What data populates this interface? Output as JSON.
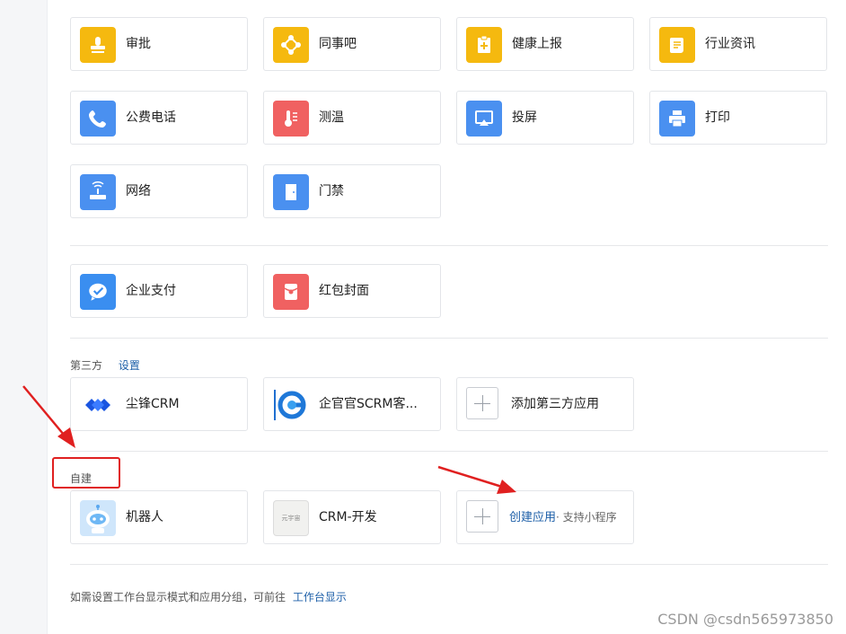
{
  "apps_basic": [
    {
      "label": "审批",
      "icon": "stamp-icon",
      "color": "#f5b90f"
    },
    {
      "label": "同事吧",
      "icon": "network-icon",
      "color": "#f5b90f"
    },
    {
      "label": "健康上报",
      "icon": "health-report-icon",
      "color": "#f5b90f"
    },
    {
      "label": "行业资讯",
      "icon": "news-scroll-icon",
      "color": "#f5b90f"
    },
    {
      "label": "公费电话",
      "icon": "phone-icon",
      "color": "#4a90f0"
    },
    {
      "label": "测温",
      "icon": "thermometer-icon",
      "color": "#f06161"
    },
    {
      "label": "投屏",
      "icon": "screen-cast-icon",
      "color": "#4a90f0"
    },
    {
      "label": "打印",
      "icon": "printer-icon",
      "color": "#4a90f0"
    },
    {
      "label": "网络",
      "icon": "router-icon",
      "color": "#4a90f0"
    },
    {
      "label": "门禁",
      "icon": "door-icon",
      "color": "#4a90f0"
    }
  ],
  "apps_pay": [
    {
      "label": "企业支付",
      "icon": "wechat-pay-icon",
      "color": "#3a8ef0"
    },
    {
      "label": "红包封面",
      "icon": "red-envelope-icon",
      "color": "#f06161"
    }
  ],
  "third_party": {
    "title": "第三方",
    "settings_link": "设置",
    "apps": [
      {
        "label": "尘锋CRM",
        "icon": "chenfeng-crm-logo-icon"
      },
      {
        "label": "企官官SCRM客...",
        "icon": "qiguanguan-logo-icon"
      }
    ],
    "add_label": "添加第三方应用"
  },
  "self_built": {
    "title": "自建",
    "apps": [
      {
        "label": "机器人",
        "icon": "robot-icon"
      },
      {
        "label": "CRM-开发",
        "icon": "crm-dev-logo-icon",
        "logo_text": "元宇宙"
      }
    ],
    "create_label": "创建应用",
    "create_hint": "· 支持小程序"
  },
  "footer": {
    "text": "如需设置工作台显示模式和应用分组，可前往",
    "link": "工作台显示"
  },
  "watermark": "CSDN @csdn565973850",
  "annotation_color": "#e02020"
}
